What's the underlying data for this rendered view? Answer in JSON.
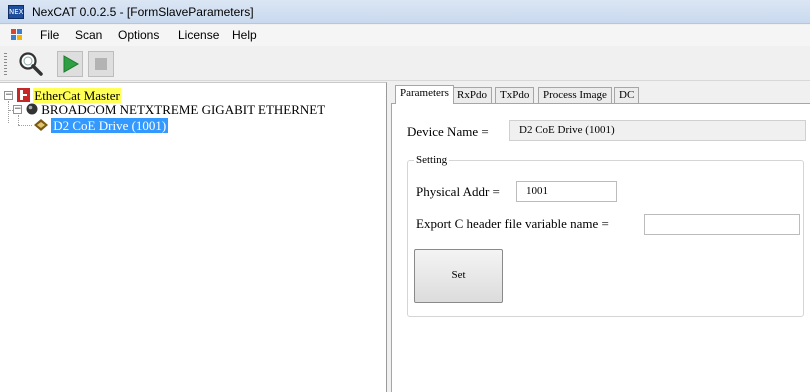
{
  "window": {
    "app_icon_text": "NEX",
    "title": "NexCAT 0.0.2.5  - [FormSlaveParameters]"
  },
  "menu": {
    "items": [
      "File",
      "Scan",
      "Options",
      "License",
      "Help"
    ]
  },
  "toolbar": {
    "buttons": [
      "scan-search-icon",
      "run-icon",
      "stop-icon"
    ]
  },
  "tree": {
    "root": "EtherCat Master",
    "adapter": "BROADCOM NETXTREME GIGABIT ETHERNET",
    "device": "D2 CoE Drive (1001)"
  },
  "tabs": [
    "Parameters",
    "RxPdo",
    "TxPdo",
    "Process Image",
    "DC"
  ],
  "params": {
    "device_name_label": "Device Name =",
    "device_name_value": "D2 CoE Drive (1001)",
    "group_title": "Setting",
    "phys_addr_label": "Physical Addr =",
    "phys_addr_value": "1001",
    "export_label": "Export C header file variable name =",
    "export_value": "",
    "set_button": "Set"
  },
  "colors": {
    "root_highlight": "#ffff55",
    "selection": "#3399ff",
    "run_green": "#2ea043",
    "title_bar": "#c9d9ee"
  }
}
